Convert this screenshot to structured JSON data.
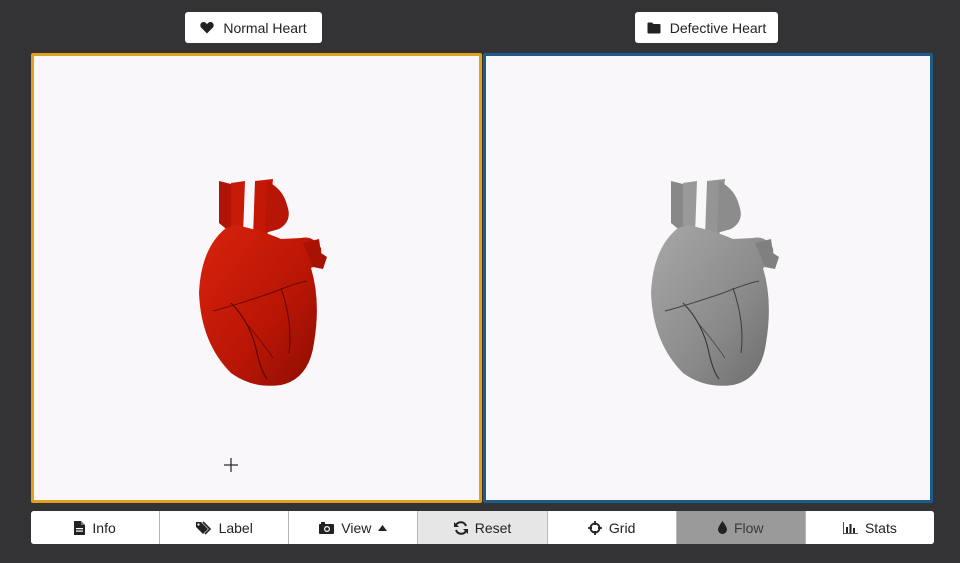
{
  "titles": {
    "left": {
      "label": "Normal Heart",
      "icon": "heart-icon"
    },
    "right": {
      "label": "Defective Heart",
      "icon": "folder-icon"
    }
  },
  "colors": {
    "left_border": "#e2a01f",
    "right_border": "#1e5a8a",
    "normal_heart": "#c41a08",
    "defective_heart": "#8c8c8c",
    "background": "#333234",
    "viewport_bg": "#f9f7fa"
  },
  "toolbar": [
    {
      "label": "Info",
      "icon": "document-icon"
    },
    {
      "label": "Label",
      "icon": "tags-icon"
    },
    {
      "label": "View",
      "icon": "camera-icon",
      "dropdown": "caret-up-icon"
    },
    {
      "label": "Reset",
      "icon": "refresh-icon"
    },
    {
      "label": "Grid",
      "icon": "crosshairs-icon"
    },
    {
      "label": "Flow",
      "icon": "drop-icon"
    },
    {
      "label": "Stats",
      "icon": "bar-chart-icon"
    }
  ]
}
